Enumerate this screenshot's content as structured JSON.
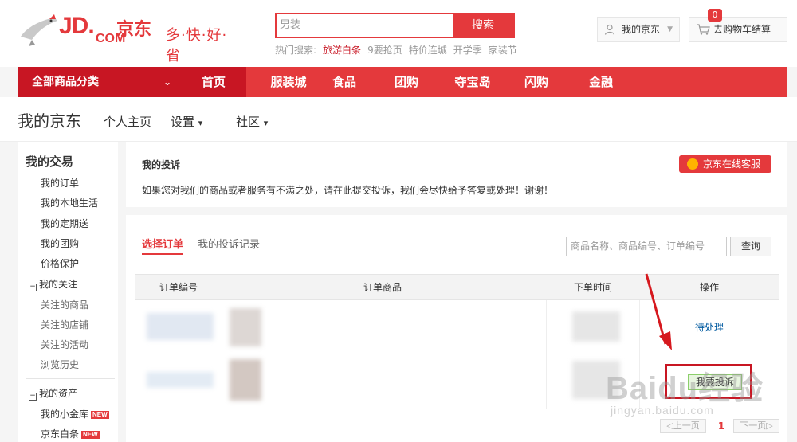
{
  "logo": {
    "brand": "JD.",
    "brand_cn": "京东",
    "brand_com": "COM",
    "slogan": "多·快·好·省"
  },
  "search": {
    "value": "男装",
    "button": "搜索"
  },
  "hot_search": {
    "label": "热门搜索:",
    "items": [
      "旅游白条",
      "9要抢页",
      "特价连城",
      "开学季",
      "家装节"
    ]
  },
  "header": {
    "my_jd": "我的京东",
    "cart": "去购物车结算",
    "cart_count": "0"
  },
  "nav": {
    "category": "全部商品分类",
    "items": [
      "首页",
      "服装城",
      "食品",
      "团购",
      "夺宝岛",
      "闪购",
      "金融"
    ]
  },
  "subheader": {
    "title": "我的京东",
    "links": [
      "个人主页",
      "设置",
      "社区"
    ]
  },
  "sidebar": {
    "section1_title": "我的交易",
    "section1_items": [
      "我的订单",
      "我的本地生活",
      "我的定期送",
      "我的团购",
      "价格保护"
    ],
    "section2_title": "我的关注",
    "section2_items": [
      "关注的商品",
      "关注的店铺",
      "关注的活动",
      "浏览历史"
    ],
    "section3_title": "我的资产",
    "section3_items": [
      "我的小金库",
      "京东白条"
    ],
    "new_tag": "NEW"
  },
  "complaint": {
    "title": "我的投诉",
    "description": "如果您对我们的商品或者服务有不满之处，请在此提交投诉，我们会尽快给予答复或处理！谢谢！",
    "service_button": "京东在线客服"
  },
  "orders": {
    "tabs": [
      "选择订单",
      "我的投诉记录"
    ],
    "query_placeholder": "商品名称、商品编号、订单编号",
    "query_button": "查询",
    "columns": [
      "订单编号",
      "订单商品",
      "下单时间",
      "操作"
    ],
    "rows": [
      {
        "action": "待处理"
      },
      {
        "action": "我要投诉"
      }
    ]
  },
  "pager": {
    "prev": "上一页",
    "current": "1",
    "next": "下一页"
  },
  "watermark": {
    "main": "Baidu经验",
    "sub": "jingyan.baidu.com"
  },
  "colors": {
    "brand_red": "#e4393c",
    "dark_red": "#c81623",
    "link_blue": "#005aa0"
  }
}
